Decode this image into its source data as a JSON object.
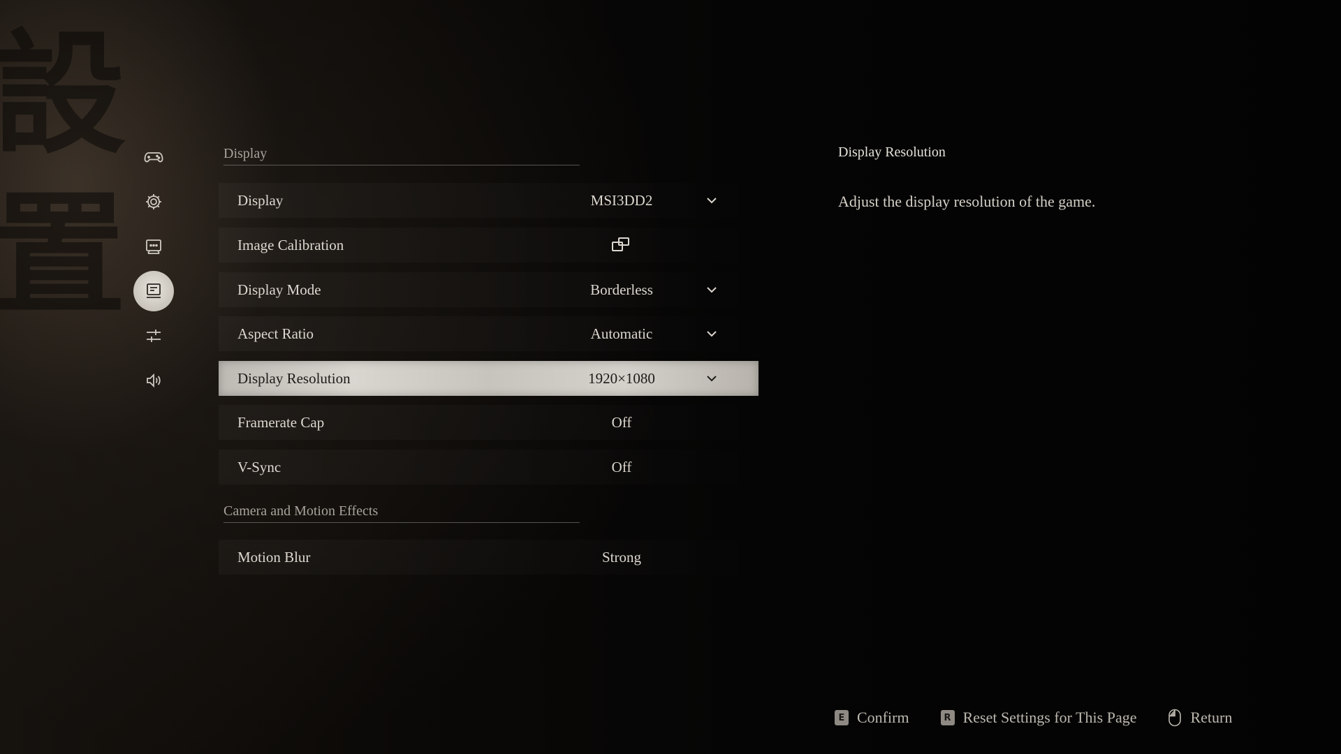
{
  "background": {
    "calligraphy": [
      "設",
      "置"
    ]
  },
  "sidebar": {
    "items": [
      {
        "icon": "gamepad-icon",
        "active": false
      },
      {
        "icon": "gear-icon",
        "active": false
      },
      {
        "icon": "subtitle-icon",
        "active": false
      },
      {
        "icon": "monitor-icon",
        "active": true
      },
      {
        "icon": "sliders-icon",
        "active": false
      },
      {
        "icon": "audio-icon",
        "active": false
      }
    ]
  },
  "sections": {
    "display_header": "Display",
    "camera_header": "Camera and Motion Effects"
  },
  "rows": [
    {
      "label": "Display",
      "value": "MSI3DD2",
      "control": "dropdown"
    },
    {
      "label": "Image Calibration",
      "value": "",
      "control": "external-link-icon"
    },
    {
      "label": "Display Mode",
      "value": "Borderless",
      "control": "dropdown"
    },
    {
      "label": "Aspect Ratio",
      "value": "Automatic",
      "control": "dropdown"
    },
    {
      "label": "Display Resolution",
      "value": "1920×1080",
      "control": "dropdown",
      "selected": true
    },
    {
      "label": "Framerate Cap",
      "value": "Off",
      "control": "none"
    },
    {
      "label": "V-Sync",
      "value": "Off",
      "control": "none"
    },
    {
      "label": "Motion Blur",
      "value": "Strong",
      "control": "none"
    }
  ],
  "description": {
    "title": "Display Resolution",
    "text": "Adjust the display resolution of the game."
  },
  "footer": {
    "confirm": {
      "key": "E",
      "label": "Confirm"
    },
    "reset": {
      "key": "R",
      "label": "Reset Settings for This Page"
    },
    "return": {
      "icon": "mouse-icon",
      "label": "Return"
    }
  },
  "colors": {
    "selected_row": "#d2cfc9",
    "text": "#ddd8cf",
    "background": "#050505"
  }
}
